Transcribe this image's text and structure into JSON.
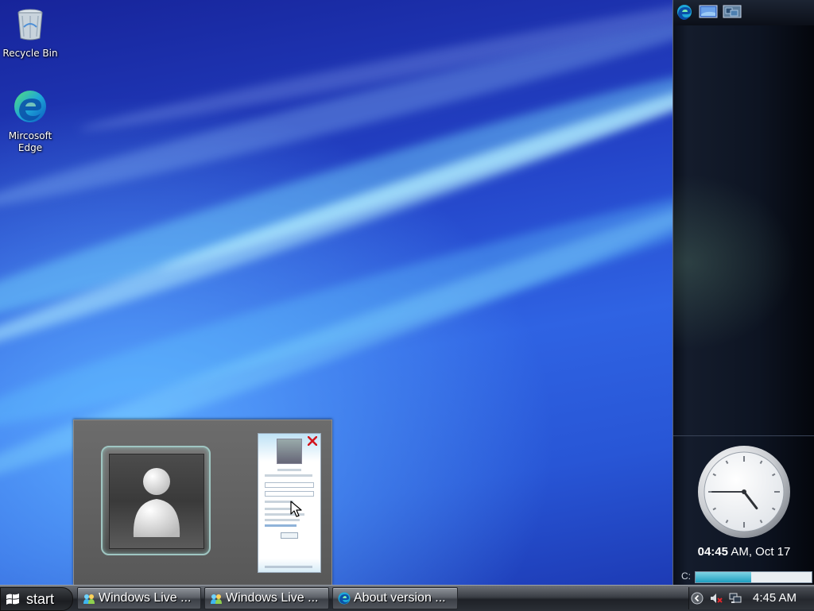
{
  "desktop": {
    "icons": [
      {
        "label": "Recycle Bin",
        "icon": "recycle-bin-icon"
      },
      {
        "label": "Mircosoft Edge",
        "icon": "edge-icon"
      }
    ]
  },
  "sidebar": {
    "toolbar_icons": [
      "edge-icon",
      "desktop-icon",
      "monitor-icon"
    ],
    "clock": {
      "time_bold": "04:45",
      "time_rest": " AM, Oct 17",
      "hour": 4,
      "minute": 45
    },
    "drive": {
      "label": "C:",
      "used_fraction": 0.48
    }
  },
  "preview": {
    "close_icon": "close-icon",
    "avatar_icon": "messenger-buddy-icon"
  },
  "taskbar": {
    "start_label": "start",
    "buttons": [
      {
        "label": "Windows Live ...",
        "icon": "windows-live-icon"
      },
      {
        "label": "Windows Live ...",
        "icon": "windows-live-icon"
      },
      {
        "label": "About version ...",
        "icon": "edge-icon"
      }
    ],
    "tray": {
      "icons": [
        "show-hidden-icons-icon",
        "volume-muted-icon",
        "network-icon"
      ],
      "time": "4:45 AM"
    }
  },
  "colors": {
    "accent": "#2f63e3",
    "sidebar_bg": "#0d1422",
    "drive_fill": "#1f9fc0"
  }
}
